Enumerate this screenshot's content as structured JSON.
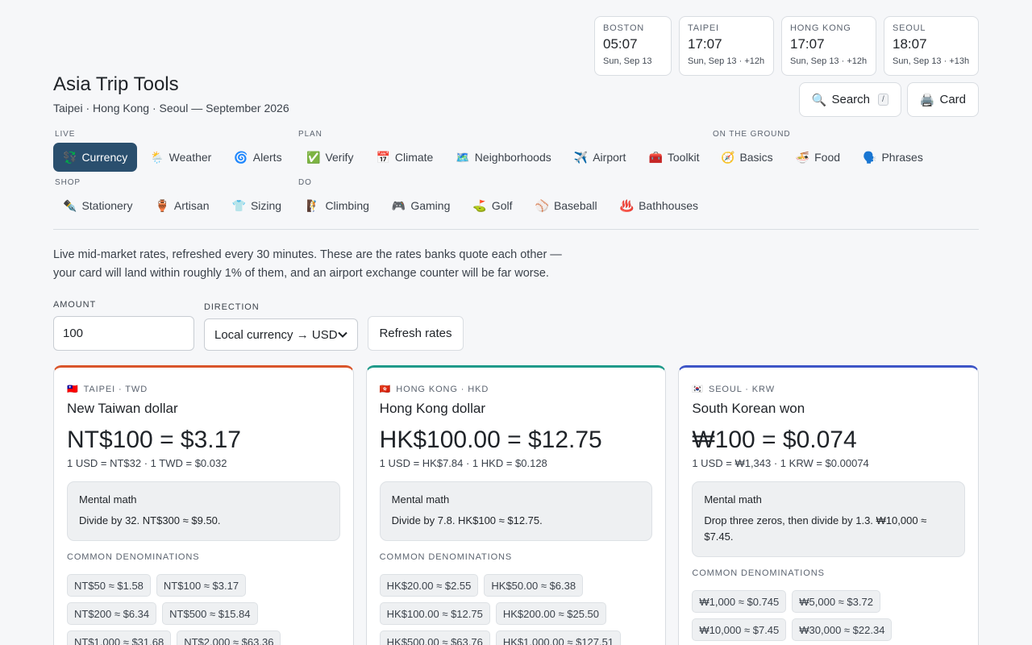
{
  "clocks": [
    {
      "city": "BOSTON",
      "time": "05:07",
      "date": "Sun, Sep 13"
    },
    {
      "city": "TAIPEI",
      "time": "17:07",
      "date": "Sun, Sep 13 · +12h"
    },
    {
      "city": "HONG KONG",
      "time": "17:07",
      "date": "Sun, Sep 13 · +12h"
    },
    {
      "city": "SEOUL",
      "time": "18:07",
      "date": "Sun, Sep 13 · +13h"
    }
  ],
  "header": {
    "title": "Asia Trip Tools",
    "subtitle": "Taipei · Hong Kong · Seoul — September 2026",
    "search_label": "Search",
    "search_kbd": "/",
    "card_label": "Card",
    "search_icon": "🔍",
    "card_icon": "🖨️"
  },
  "nav": {
    "live": {
      "label": "LIVE",
      "items": [
        {
          "icon": "💱",
          "label": "Currency",
          "active": true
        },
        {
          "icon": "🌦️",
          "label": "Weather"
        },
        {
          "icon": "🌀",
          "label": "Alerts"
        }
      ]
    },
    "plan": {
      "label": "PLAN",
      "items": [
        {
          "icon": "✅",
          "label": "Verify"
        },
        {
          "icon": "📅",
          "label": "Climate"
        },
        {
          "icon": "🗺️",
          "label": "Neighborhoods"
        },
        {
          "icon": "✈️",
          "label": "Airport"
        },
        {
          "icon": "🧰",
          "label": "Toolkit"
        }
      ]
    },
    "ground": {
      "label": "ON THE GROUND",
      "items": [
        {
          "icon": "🧭",
          "label": "Basics"
        },
        {
          "icon": "🍜",
          "label": "Food"
        },
        {
          "icon": "🗣️",
          "label": "Phrases"
        }
      ]
    },
    "shop": {
      "label": "SHOP",
      "items": [
        {
          "icon": "✒️",
          "label": "Stationery"
        },
        {
          "icon": "🏺",
          "label": "Artisan"
        },
        {
          "icon": "👕",
          "label": "Sizing"
        }
      ]
    },
    "do": {
      "label": "DO",
      "items": [
        {
          "icon": "🧗",
          "label": "Climbing"
        },
        {
          "icon": "🎮",
          "label": "Gaming"
        },
        {
          "icon": "⛳",
          "label": "Golf"
        },
        {
          "icon": "⚾",
          "label": "Baseball"
        },
        {
          "icon": "♨️",
          "label": "Bathhouses"
        }
      ]
    }
  },
  "intro": "Live mid-market rates, refreshed every 30 minutes. These are the rates banks quote each other — your card will land within roughly 1% of them, and an airport exchange counter will be far worse.",
  "controls": {
    "amount_label": "AMOUNT",
    "amount_value": "100",
    "direction_label": "DIRECTION",
    "direction_value": "Local currency → USD",
    "refresh_label": "Refresh rates"
  },
  "cards": [
    {
      "flag": "🇹🇼",
      "tag": "TAIPEI · TWD",
      "name": "New Taiwan dollar",
      "rate": "NT$100 = $3.17",
      "sub": "1 USD = NT$32 · 1 TWD = $0.032",
      "mental_title": "Mental math",
      "mental_text": "Divide by 32. NT$300 ≈ $9.50.",
      "denom_label": "COMMON DENOMINATIONS",
      "chips": [
        "NT$50 ≈ $1.58",
        "NT$100 ≈ $3.17",
        "NT$200 ≈ $6.34",
        "NT$500 ≈ $15.84",
        "NT$1,000 ≈ $31.68",
        "NT$2,000 ≈ $63.36"
      ]
    },
    {
      "flag": "🇭🇰",
      "tag": "HONG KONG · HKD",
      "name": "Hong Kong dollar",
      "rate": "HK$100.00 = $12.75",
      "sub": "1 USD = HK$7.84 · 1 HKD = $0.128",
      "mental_title": "Mental math",
      "mental_text": "Divide by 7.8. HK$100 ≈ $12.75.",
      "denom_label": "COMMON DENOMINATIONS",
      "chips": [
        "HK$20.00 ≈ $2.55",
        "HK$50.00 ≈ $6.38",
        "HK$100.00 ≈ $12.75",
        "HK$200.00 ≈ $25.50",
        "HK$500.00 ≈ $63.76",
        "HK$1,000.00 ≈ $127.51"
      ]
    },
    {
      "flag": "🇰🇷",
      "tag": "SEOUL · KRW",
      "name": "South Korean won",
      "rate": "₩100 = $0.074",
      "sub": "1 USD = ₩1,343 · 1 KRW = $0.00074",
      "mental_title": "Mental math",
      "mental_text": "Drop three zeros, then divide by 1.3. ₩10,000 ≈ $7.45.",
      "denom_label": "COMMON DENOMINATIONS",
      "chips": [
        "₩1,000 ≈ $0.745",
        "₩5,000 ≈ $3.72",
        "₩10,000 ≈ $7.45",
        "₩30,000 ≈ $22.34"
      ]
    }
  ]
}
